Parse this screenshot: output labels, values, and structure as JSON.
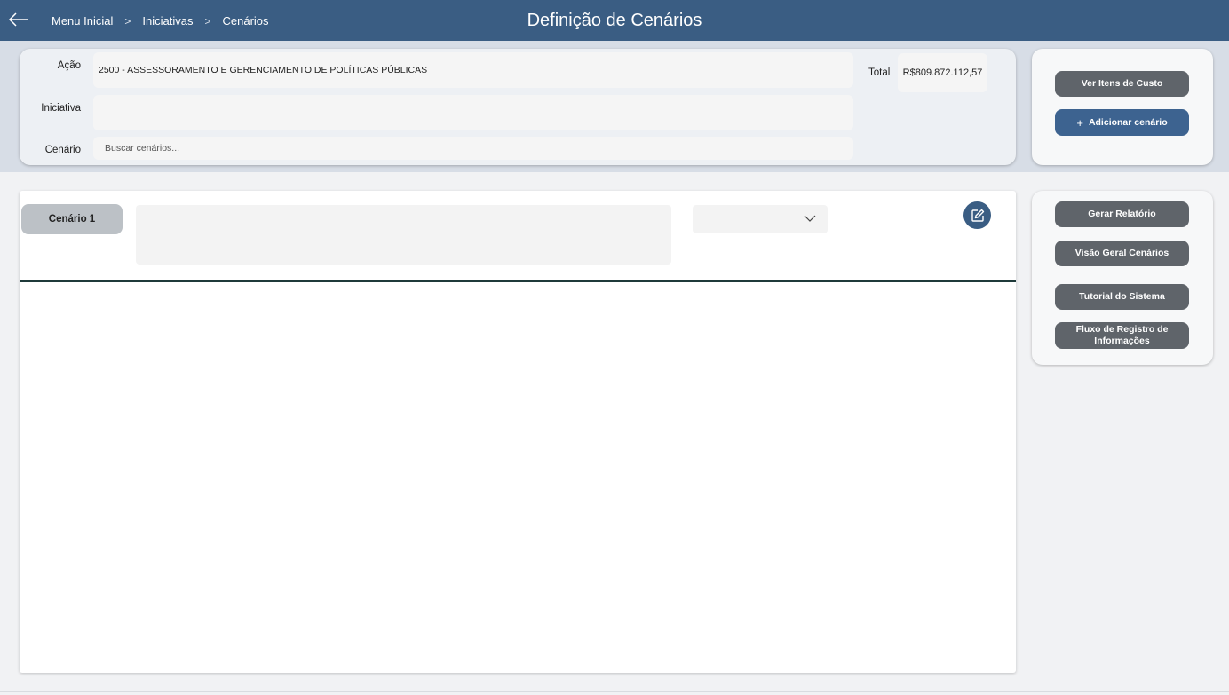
{
  "header": {
    "title": "Definição de Cenários",
    "breadcrumbs": [
      {
        "label": "Menu Inicial"
      },
      {
        "label": "Iniciativas"
      },
      {
        "label": "Cenários"
      }
    ]
  },
  "form": {
    "acao_label": "Ação",
    "acao_value": "2500 - ASSESSORAMENTO E GERENCIAMENTO DE POLÍTICAS PÚBLICAS",
    "iniciativa_label": "Iniciativa",
    "iniciativa_value": "",
    "cenario_label": "Cenário",
    "cenario_placeholder": "Buscar cenários...",
    "total_label": "Total",
    "total_value": "R$809.872.112,57"
  },
  "actions_top": {
    "ver_itens": "Ver Itens de Custo",
    "adicionar": "Adicionar cenário"
  },
  "actions_side": {
    "gerar_relatorio": "Gerar Relatório",
    "visao_geral": "Visão Geral Cenários",
    "tutorial": "Tutorial do Sistema",
    "fluxo": "Fluxo de Registro de Informações"
  },
  "scenario": {
    "tab_label": "Cenário 1",
    "description": "",
    "selected_option": ""
  },
  "colors": {
    "topbar": "#3a5d83",
    "primary_button": "#3d6390",
    "secondary_button": "#5f646a",
    "divider": "#1f3a3a"
  },
  "icons": {
    "back": "arrow-left-icon",
    "separator": "chevron-right-icon",
    "dropdown": "chevron-down-icon",
    "edit": "edit-icon",
    "add": "plus-icon"
  }
}
